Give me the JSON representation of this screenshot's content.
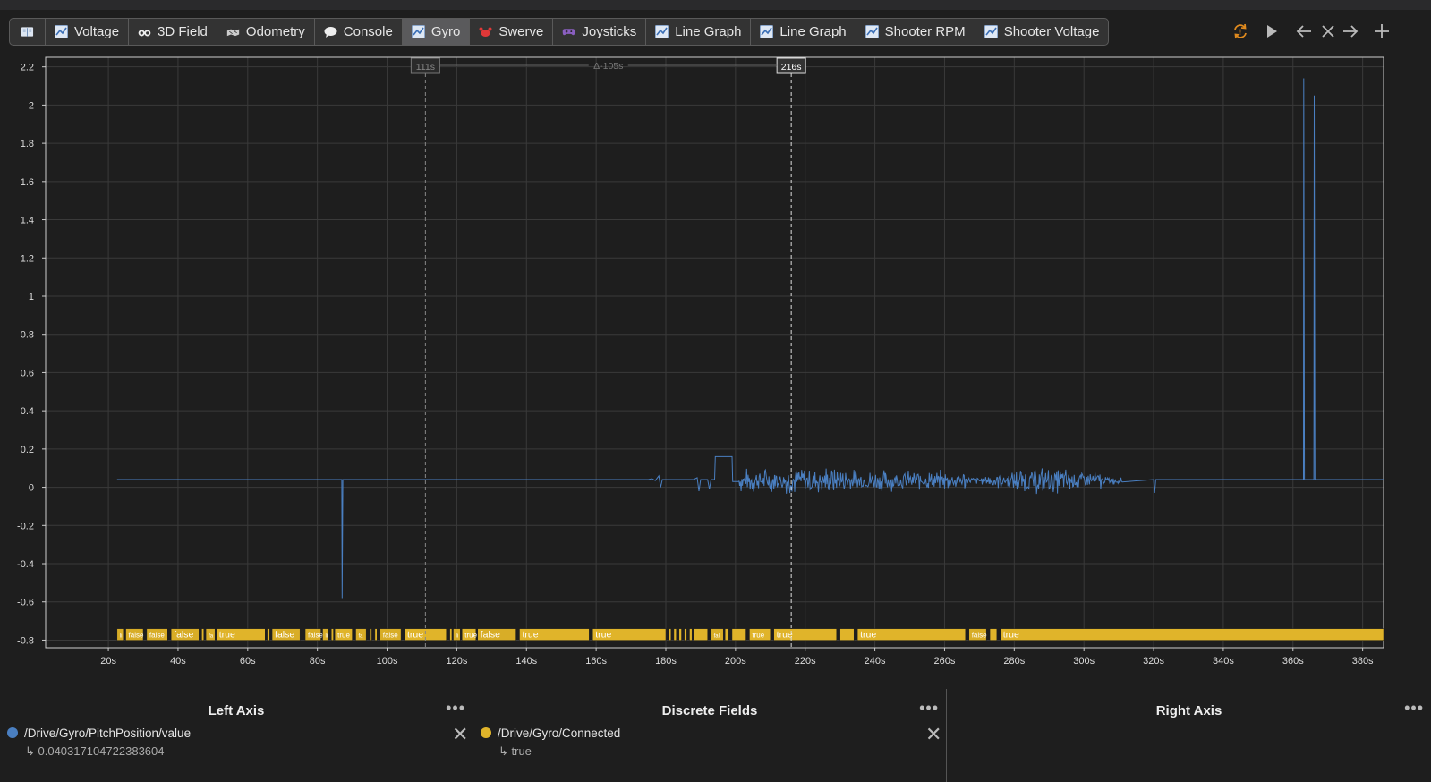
{
  "tabs": [
    {
      "label": "",
      "icon": "book-icon",
      "active": false
    },
    {
      "label": "Voltage",
      "icon": "line-graph-icon",
      "active": false
    },
    {
      "label": "3D Field",
      "icon": "binoculars-icon",
      "active": false
    },
    {
      "label": "Odometry",
      "icon": "field-map-icon",
      "active": false
    },
    {
      "label": "Console",
      "icon": "speech-bubble-icon",
      "active": false
    },
    {
      "label": "Gyro",
      "icon": "line-graph-icon",
      "active": true
    },
    {
      "label": "Swerve",
      "icon": "crab-icon",
      "active": false
    },
    {
      "label": "Joysticks",
      "icon": "gamepad-icon",
      "active": false
    },
    {
      "label": "Line Graph",
      "icon": "line-graph-icon",
      "active": false
    },
    {
      "label": "Line Graph",
      "icon": "line-graph-icon",
      "active": false
    },
    {
      "label": "Shooter RPM",
      "icon": "line-graph-icon",
      "active": false
    },
    {
      "label": "Shooter Voltage",
      "icon": "line-graph-icon",
      "active": false
    }
  ],
  "controls": [
    "sync-icon",
    "play-icon",
    "arrow-left-icon",
    "close-icon",
    "arrow-right-icon",
    "plus-icon"
  ],
  "colors": {
    "series": "#4a7fc1",
    "discrete": "#e0b42a",
    "accent": "#e08a1e",
    "grid": "#3a3a3a"
  },
  "chart_data": {
    "type": "line",
    "xlim": [
      2,
      386
    ],
    "ylim": [
      -0.84,
      2.25
    ],
    "y_ticks": [
      -0.8,
      -0.6,
      -0.4,
      -0.2,
      0,
      0.2,
      0.4,
      0.6,
      0.8,
      1,
      1.2,
      1.4,
      1.6,
      1.8,
      2,
      2.2
    ],
    "y_tick_labels": [
      "-0.8",
      "-0.6",
      "-0.4",
      "-0.2",
      "0",
      "0.2",
      "0.4",
      "0.6",
      "0.8",
      "1",
      "1.2",
      "1.4",
      "1.6",
      "1.8",
      "2",
      "2.2"
    ],
    "x_ticks": [
      20,
      40,
      60,
      80,
      100,
      120,
      140,
      160,
      180,
      200,
      220,
      240,
      260,
      280,
      300,
      320,
      340,
      360,
      380
    ],
    "x_tick_labels": [
      "20s",
      "40s",
      "60s",
      "80s",
      "100s",
      "120s",
      "140s",
      "160s",
      "180s",
      "200s",
      "220s",
      "240s",
      "260s",
      "280s",
      "300s",
      "320s",
      "340s",
      "360s",
      "380s"
    ],
    "grid": true,
    "cursor_a": {
      "x": 111,
      "label": "111s"
    },
    "cursor_b": {
      "x": 216,
      "label": "216s"
    },
    "delta_label": "Δ-105s",
    "series": [
      {
        "name": "/Drive/Gyro/PitchPosition/value",
        "color": "#4a7fc1",
        "points": [
          [
            22.5,
            0.04
          ],
          [
            87,
            0.04
          ],
          [
            87.1,
            -0.58
          ],
          [
            87.3,
            0.04
          ],
          [
            175,
            0.04
          ],
          [
            176,
            0.045
          ],
          [
            177,
            0.035
          ],
          [
            178,
            0.06
          ],
          [
            178.5,
            0.0
          ],
          [
            179,
            0.04
          ],
          [
            188,
            0.04
          ],
          [
            189,
            0.05
          ],
          [
            189.5,
            -0.02
          ],
          [
            190,
            0.04
          ],
          [
            192,
            0.04
          ],
          [
            192.5,
            -0.01
          ],
          [
            193,
            0.04
          ],
          [
            194,
            0.04
          ],
          [
            194.2,
            0.16
          ],
          [
            199,
            0.16
          ],
          [
            199.2,
            0.03
          ],
          [
            201,
            0.03
          ],
          [
            320,
            0.04
          ],
          [
            320.3,
            -0.03
          ],
          [
            320.6,
            0.04
          ],
          [
            363,
            0.04
          ],
          [
            363.1,
            2.14
          ],
          [
            363.3,
            0.04
          ],
          [
            366,
            0.04
          ],
          [
            366.1,
            2.05
          ],
          [
            366.3,
            0.04
          ],
          [
            386,
            0.04
          ]
        ],
        "noise": [
          [
            201,
            214,
            0.06
          ],
          [
            214,
            232,
            0.07
          ],
          [
            232,
            243,
            0.055
          ],
          [
            243,
            266,
            0.05
          ],
          [
            266,
            272,
            0.02
          ],
          [
            272,
            280,
            0.04
          ],
          [
            280,
            296,
            0.065
          ],
          [
            296,
            305,
            0.05
          ],
          [
            305,
            311,
            0.02
          ]
        ]
      }
    ],
    "discrete": {
      "name": "/Drive/Gyro/Connected",
      "segments": [
        {
          "x1": 22.5,
          "x2": 24.3,
          "label": "li"
        },
        {
          "x1": 25,
          "x2": 30,
          "label": "false"
        },
        {
          "x1": 31,
          "x2": 37,
          "label": "false"
        },
        {
          "x1": 38,
          "x2": 46,
          "label": "false"
        },
        {
          "x1": 46.8,
          "x2": 47.4,
          "label": ""
        },
        {
          "x1": 48,
          "x2": 50.6,
          "label": "fa"
        },
        {
          "x1": 51,
          "x2": 65,
          "label": "true"
        },
        {
          "x1": 65.6,
          "x2": 66.3,
          "label": ""
        },
        {
          "x1": 67,
          "x2": 75,
          "label": "false"
        },
        {
          "x1": 76.5,
          "x2": 81,
          "label": "false"
        },
        {
          "x1": 81.5,
          "x2": 83,
          "label": "li"
        },
        {
          "x1": 84,
          "x2": 84.6,
          "label": ""
        },
        {
          "x1": 85,
          "x2": 90,
          "label": "true"
        },
        {
          "x1": 91,
          "x2": 94,
          "label": "fa"
        },
        {
          "x1": 95,
          "x2": 95.6,
          "label": ""
        },
        {
          "x1": 96.5,
          "x2": 97.1,
          "label": ""
        },
        {
          "x1": 98,
          "x2": 104,
          "label": "false"
        },
        {
          "x1": 105,
          "x2": 117,
          "label": "true"
        },
        {
          "x1": 118,
          "x2": 118.6,
          "label": ""
        },
        {
          "x1": 119,
          "x2": 121,
          "label": "li"
        },
        {
          "x1": 121.5,
          "x2": 125.5,
          "label": "true"
        },
        {
          "x1": 126,
          "x2": 137,
          "label": "false"
        },
        {
          "x1": 138,
          "x2": 158,
          "label": "true"
        },
        {
          "x1": 159,
          "x2": 180,
          "label": "true"
        },
        {
          "x1": 180.8,
          "x2": 181.5,
          "label": ""
        },
        {
          "x1": 182.3,
          "x2": 183,
          "label": ""
        },
        {
          "x1": 183.8,
          "x2": 184.5,
          "label": ""
        },
        {
          "x1": 185.3,
          "x2": 186,
          "label": ""
        },
        {
          "x1": 186.8,
          "x2": 187.5,
          "label": ""
        },
        {
          "x1": 188,
          "x2": 192,
          "label": ""
        },
        {
          "x1": 193,
          "x2": 196.5,
          "label": "fal"
        },
        {
          "x1": 197,
          "x2": 198,
          "label": ""
        },
        {
          "x1": 199,
          "x2": 203,
          "label": ""
        },
        {
          "x1": 204,
          "x2": 210,
          "label": "true"
        },
        {
          "x1": 211,
          "x2": 229,
          "label": "true"
        },
        {
          "x1": 230,
          "x2": 234,
          "label": ""
        },
        {
          "x1": 235,
          "x2": 266,
          "label": "true"
        },
        {
          "x1": 267,
          "x2": 272,
          "label": "false"
        },
        {
          "x1": 273,
          "x2": 275,
          "label": ""
        },
        {
          "x1": 276,
          "x2": 386,
          "label": "true"
        }
      ]
    }
  },
  "legend": {
    "left": {
      "title": "Left Axis",
      "field": "/Drive/Gyro/PitchPosition/value",
      "value": "↳ 0.040317104722383604"
    },
    "discrete": {
      "title": "Discrete Fields",
      "field": "/Drive/Gyro/Connected",
      "value": "↳ true"
    },
    "right": {
      "title": "Right Axis"
    }
  }
}
